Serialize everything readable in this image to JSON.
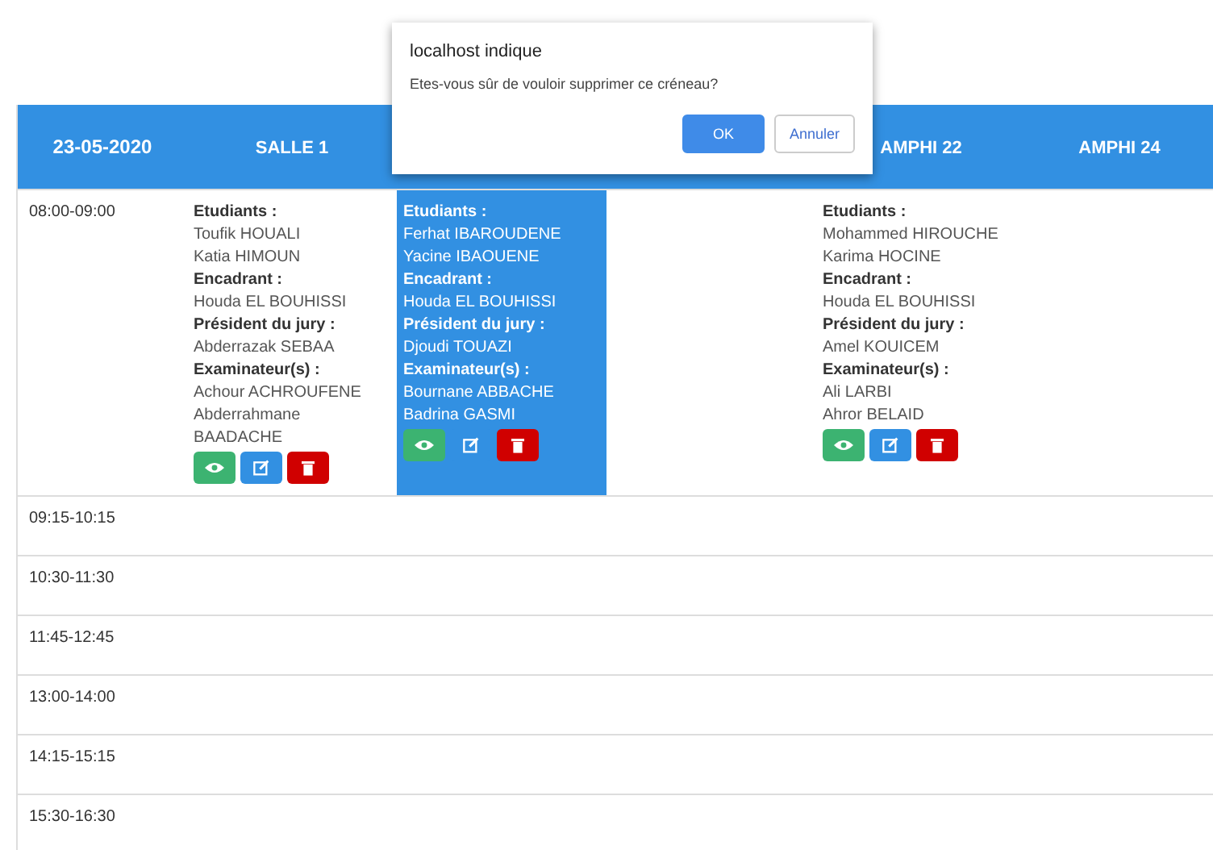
{
  "dialog": {
    "title": "localhost indique",
    "message": "Etes-vous sûr de vouloir supprimer ce créneau?",
    "buttons": [
      {
        "label": "OK",
        "kind": "primary"
      },
      {
        "label": "Annuler",
        "kind": "secondary"
      }
    ]
  },
  "table": {
    "columns": [
      {
        "label": "23-05-2020"
      },
      {
        "label": "SALLE 1"
      },
      {},
      {},
      {
        "label": "AMPHI 22"
      },
      {
        "label": "AMPHI 24"
      }
    ],
    "rows": [
      {
        "time": "08:00-09:00",
        "cells": [
          {
            "kind": "slot",
            "selected": false,
            "sections": [
              {
                "heading": "Etudiants :",
                "names": [
                  "Toufik HOUALI",
                  "Katia HIMOUN"
                ]
              },
              {
                "heading": "Encadrant :",
                "names": [
                  "Houda EL BOUHISSI"
                ]
              },
              {
                "heading": "Président du jury :",
                "names": [
                  "Abderrazak SEBAA"
                ]
              },
              {
                "heading": "Examinateur(s) :",
                "names": [
                  "Achour ACHROUFENE",
                  "Abderrahmane BAADACHE"
                ]
              }
            ]
          },
          {
            "kind": "slot",
            "selected": true,
            "sections": [
              {
                "heading": "Etudiants :",
                "names": [
                  "Ferhat IBAROUDENE",
                  "Yacine IBAOUENE"
                ]
              },
              {
                "heading": "Encadrant :",
                "names": [
                  "Houda EL BOUHISSI"
                ]
              },
              {
                "heading": "Président du jury :",
                "names": [
                  "Djoudi TOUAZI"
                ]
              },
              {
                "heading": "Examinateur(s) :",
                "names": [
                  "Bournane ABBACHE",
                  "Badrina GASMI"
                ]
              }
            ]
          },
          {
            "kind": "empty"
          },
          {
            "kind": "slot",
            "selected": false,
            "sections": [
              {
                "heading": "Etudiants :",
                "names": [
                  "Mohammed HIROUCHE",
                  "Karima HOCINE"
                ]
              },
              {
                "heading": "Encadrant :",
                "names": [
                  "Houda EL BOUHISSI"
                ]
              },
              {
                "heading": "Président du jury :",
                "names": [
                  "Amel KOUICEM"
                ]
              },
              {
                "heading": "Examinateur(s) :",
                "names": [
                  "Ali LARBI",
                  "Ahror BELAID"
                ]
              }
            ]
          },
          {
            "kind": "empty"
          }
        ]
      },
      {
        "time": "09:15-10:15"
      },
      {
        "time": "10:30-11:30"
      },
      {
        "time": "11:45-12:45"
      },
      {
        "time": "13:00-14:00"
      },
      {
        "time": "14:15-15:15"
      },
      {
        "time": "15:30-16:30"
      }
    ]
  }
}
